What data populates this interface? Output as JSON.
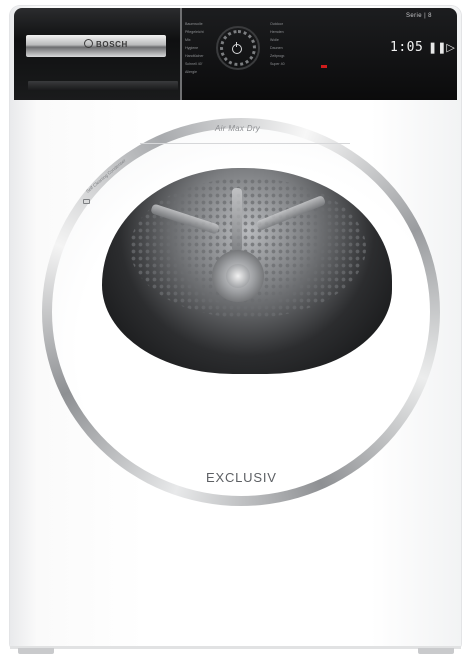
{
  "appliance": {
    "brand": "BOSCH",
    "series_badge": "Serie | 8",
    "door_label": "Air Max Dry",
    "self_clean_label": "Self Cleaning Condenser",
    "model_badge": "EXCLUSIV"
  },
  "control_panel": {
    "display_value": "1:05",
    "program_labels_left": [
      "Baumwolle",
      "Pflegeleicht",
      "Mix",
      "Hygiene",
      "Handtücher",
      "Schnell 40'",
      "Allergie"
    ],
    "program_labels_right": [
      "Outdoor",
      "Hemden",
      "Wolle",
      "Daunen",
      "Zeitprogr.",
      "Super 40"
    ]
  },
  "colors": {
    "panel": "#0b0b0c",
    "chrome": "#a8aaad",
    "accent_red": "#d01c1c",
    "body": "#ffffff"
  },
  "icons": [
    "power-icon",
    "start-pause-icon",
    "program-knob-icon",
    "self-clean-icon",
    "brand-logo-icon"
  ]
}
